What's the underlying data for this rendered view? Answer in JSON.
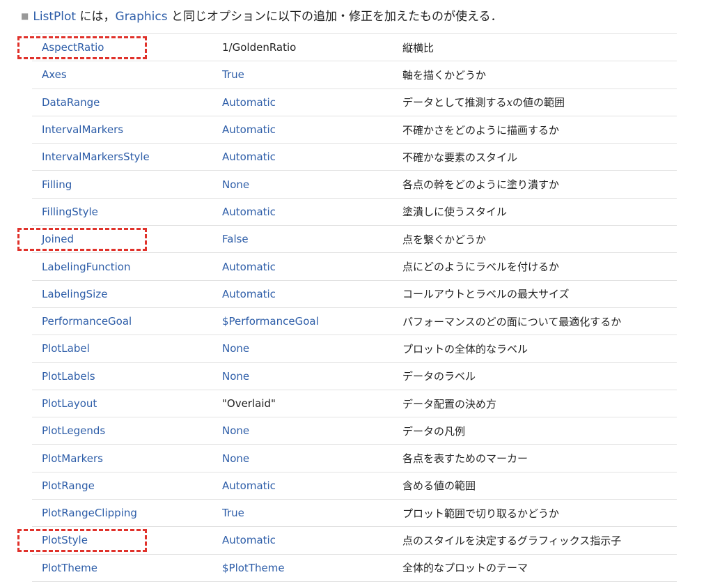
{
  "intro": {
    "bullet": "■",
    "listplot_link": "ListPlot",
    "text_1": " には，",
    "graphics_link": "Graphics",
    "text_2": " と同じオプションに以下の追加・修正を加えたものが使える．"
  },
  "options": [
    {
      "name": "AspectRatio",
      "value": "1/GoldenRatio",
      "value_style": "plain",
      "desc": "縦横比",
      "highlighted": true
    },
    {
      "name": "Axes",
      "value": "True",
      "value_style": "link",
      "desc": "軸を描くかどうか",
      "highlighted": false
    },
    {
      "name": "DataRange",
      "value": "Automatic",
      "value_style": "link",
      "desc": "データとして推測するxの値の範囲",
      "highlighted": false
    },
    {
      "name": "IntervalMarkers",
      "value": "Automatic",
      "value_style": "link",
      "desc": "不確かさをどのように描画するか",
      "highlighted": false
    },
    {
      "name": "IntervalMarkersStyle",
      "value": "Automatic",
      "value_style": "link",
      "desc": "不確かな要素のスタイル",
      "highlighted": false
    },
    {
      "name": "Filling",
      "value": "None",
      "value_style": "link",
      "desc": "各点の幹をどのように塗り潰すか",
      "highlighted": false
    },
    {
      "name": "FillingStyle",
      "value": "Automatic",
      "value_style": "link",
      "desc": "塗潰しに使うスタイル",
      "highlighted": false
    },
    {
      "name": "Joined",
      "value": "False",
      "value_style": "link",
      "desc": "点を繋ぐかどうか",
      "highlighted": true
    },
    {
      "name": "LabelingFunction",
      "value": "Automatic",
      "value_style": "link",
      "desc": "点にどのようにラベルを付けるか",
      "highlighted": false
    },
    {
      "name": "LabelingSize",
      "value": "Automatic",
      "value_style": "link",
      "desc": "コールアウトとラベルの最大サイズ",
      "highlighted": false
    },
    {
      "name": "PerformanceGoal",
      "value": "$PerformanceGoal",
      "value_style": "link",
      "desc": "パフォーマンスのどの面について最適化するか",
      "highlighted": false
    },
    {
      "name": "PlotLabel",
      "value": "None",
      "value_style": "link",
      "desc": "プロットの全体的なラベル",
      "highlighted": false
    },
    {
      "name": "PlotLabels",
      "value": "None",
      "value_style": "link",
      "desc": "データのラベル",
      "highlighted": false
    },
    {
      "name": "PlotLayout",
      "value": "\"Overlaid\"",
      "value_style": "plain",
      "desc": "データ配置の決め方",
      "highlighted": false
    },
    {
      "name": "PlotLegends",
      "value": "None",
      "value_style": "link",
      "desc": "データの凡例",
      "highlighted": false
    },
    {
      "name": "PlotMarkers",
      "value": "None",
      "value_style": "link",
      "desc": "各点を表すためのマーカー",
      "highlighted": false
    },
    {
      "name": "PlotRange",
      "value": "Automatic",
      "value_style": "link",
      "desc": "含める値の範囲",
      "highlighted": false
    },
    {
      "name": "PlotRangeClipping",
      "value": "True",
      "value_style": "link",
      "desc": "プロット範囲で切り取るかどうか",
      "highlighted": false
    },
    {
      "name": "PlotStyle",
      "value": "Automatic",
      "value_style": "link",
      "desc": "点のスタイルを決定するグラフィックス指示子",
      "highlighted": true
    },
    {
      "name": "PlotTheme",
      "value": "$PlotTheme",
      "value_style": "link",
      "desc": "全体的なプロットのテーマ",
      "highlighted": false
    }
  ],
  "colors": {
    "link": "#2d5da8",
    "text": "#222222",
    "rule": "#e2e2e2",
    "highlight": "#e0322b"
  }
}
